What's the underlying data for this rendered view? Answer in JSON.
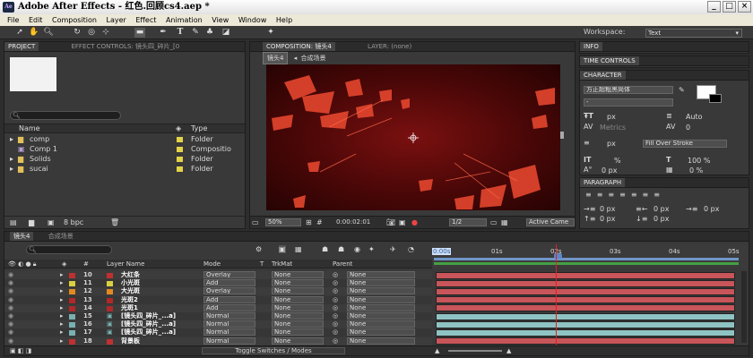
{
  "window": {
    "title": "Adobe After Effects - 红色.回顾cs4.aep *",
    "minimize": "_",
    "restore": "□",
    "close": "×"
  },
  "menu": [
    "File",
    "Edit",
    "Composition",
    "Layer",
    "Effect",
    "Animation",
    "View",
    "Window",
    "Help"
  ],
  "workspace": {
    "label": "Workspace:",
    "value": "Text"
  },
  "project_panel": {
    "tabs": [
      "PROJECT",
      "EFFECT CONTROLS: 镜头四_碎片_[0"
    ],
    "columns": {
      "name": "Name",
      "type": "Type"
    },
    "items": [
      {
        "name": "comp",
        "type": "Folder",
        "kind": "folder"
      },
      {
        "name": "Comp 1",
        "type": "Compositio",
        "kind": "comp"
      },
      {
        "name": "Solids",
        "type": "Folder",
        "kind": "folder"
      },
      {
        "name": "sucai",
        "type": "Folder",
        "kind": "folder"
      }
    ],
    "bpc": "8 bpc"
  },
  "composition_panel": {
    "tab": "COMPOSITION: 镜头4",
    "layer_tab": "LAYER: (none)",
    "breadcrumbs": [
      "镜头4",
      "合成场景"
    ],
    "zoom": "50%",
    "timecode": "0:00:02:01",
    "resolution": "1/2",
    "camera": "Active Came"
  },
  "right_panels": {
    "info": "INFO",
    "time_controls": "TIME CONTROLS",
    "character": {
      "title": "CHARACTER",
      "font": "方正超粗黑简体",
      "style": "-",
      "size": "px",
      "leading": "Auto",
      "kerning": "Metrics",
      "tracking": "0",
      "stroke_width": "px",
      "stroke_mode": "Fill Over Stroke",
      "vscale": "%",
      "hscale": "100 %",
      "baseline": "0 px",
      "tsume": "0 %"
    },
    "paragraph": {
      "title": "PARAGRAPH",
      "indent_left": "0 px",
      "indent_right": "0 px",
      "indent_first": "0 px",
      "space_before": "0 px",
      "space_after": "0 px"
    }
  },
  "timeline": {
    "tabs": [
      "镜头4",
      "合成场景"
    ],
    "columns": {
      "num": "#",
      "layer_name": "Layer Name",
      "mode": "Mode",
      "t": "T",
      "trkmat": "TrkMat",
      "parent": "Parent"
    },
    "ruler": [
      "0:00s",
      "01s",
      "02s",
      "03s",
      "04s",
      "05s"
    ],
    "layers": [
      {
        "num": "10",
        "name": "大红条",
        "color": "#c03030",
        "mode": "Overlay",
        "trkmat": "None",
        "parent": "None",
        "bar": "red"
      },
      {
        "num": "11",
        "name": "小光斑",
        "color": "#d8d040",
        "mode": "Add",
        "trkmat": "None",
        "parent": "None",
        "bar": "red"
      },
      {
        "num": "12",
        "name": "大光斑",
        "color": "#e08a20",
        "mode": "Overlay",
        "trkmat": "None",
        "parent": "None",
        "bar": "red"
      },
      {
        "num": "13",
        "name": "光斑2",
        "color": "#b02828",
        "mode": "Add",
        "trkmat": "None",
        "parent": "None",
        "bar": "red"
      },
      {
        "num": "14",
        "name": "光斑1",
        "color": "#b02828",
        "mode": "Add",
        "trkmat": "None",
        "parent": "None",
        "bar": "red"
      },
      {
        "num": "15",
        "name": "[镜头四_碎片_...a]",
        "color": "#7ab0b0",
        "mode": "Normal",
        "trkmat": "None",
        "parent": "None",
        "bar": "teal"
      },
      {
        "num": "16",
        "name": "[镜头四_碎片_...a]",
        "color": "#7ab0b0",
        "mode": "Normal",
        "trkmat": "None",
        "parent": "None",
        "bar": "teal"
      },
      {
        "num": "17",
        "name": "[镜头四_碎片_...a]",
        "color": "#7ab0b0",
        "mode": "Normal",
        "trkmat": "None",
        "parent": "None",
        "bar": "teal"
      },
      {
        "num": "18",
        "name": "背景板",
        "color": "#c03030",
        "mode": "Normal",
        "trkmat": "None",
        "parent": "None",
        "bar": "red"
      }
    ],
    "toggle": "Toggle Switches / Modes",
    "current_time": "0:00:02:01"
  },
  "colors": {
    "panel": "#393939",
    "accent": "#3a6ea5",
    "red_bar": "#c8555a",
    "teal_bar": "#8fc3c3",
    "cti": "#e02020"
  }
}
